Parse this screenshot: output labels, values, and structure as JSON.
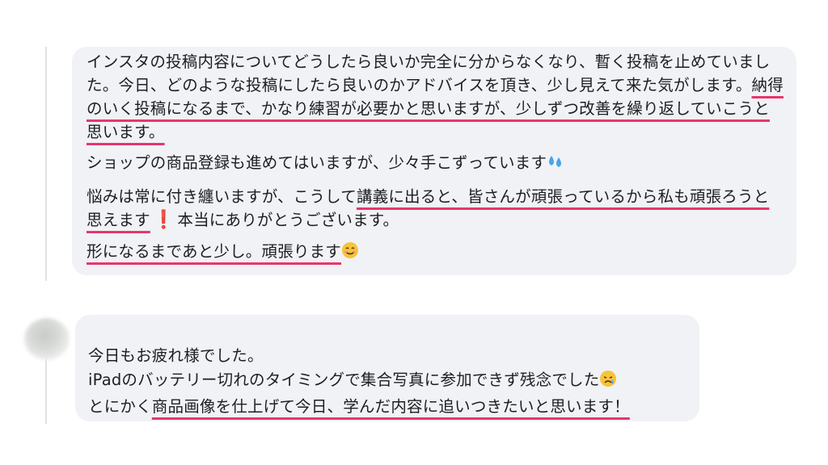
{
  "post": {
    "paragraphs": [
      {
        "segments": [
          {
            "text": "インスタの投稿内容についてどうしたら良いか完全に分からなくなり、暫く投稿を止めていました。今日、どのような投稿にしたら良いのかアドバイスを頂き、少し見えて来た気がします。",
            "u": false
          },
          {
            "text": "納得のいく投稿になるまで、かなり練習が必要かと思いますが、少しずつ改善を繰り返していこうと思います。",
            "u": true
          }
        ]
      },
      {
        "segments": [
          {
            "text": "ショップの商品登録も進めてはいますが、少々手こずっています",
            "u": false
          }
        ],
        "emoji": "sweat-droplets-icon"
      },
      {
        "segments": [
          {
            "text": "悩みは常に付き纏いますが、こうして",
            "u": false
          },
          {
            "text": "講義に出ると、皆さんが頑張っているから私も頑張ろうと思えます",
            "u": true
          },
          {
            "text": "本当にありがとうございます。",
            "u": false
          }
        ],
        "emoji": "exclamation-icon"
      },
      {
        "segments": [
          {
            "text": "形になるまであと少し。頑張ります",
            "u": true
          }
        ],
        "emoji": "smiling-face-icon"
      }
    ]
  },
  "reply": {
    "author": "",
    "line1": "今日もお疲れ様でした。",
    "line2": "iPadのバッテリー切れのタイミングで集合写真に参加できず残念でした",
    "line2_emoji": "crying-face-icon",
    "line3_pre": "とにかく",
    "line3_under": "商品画像を仕上げて今日、学んだ内容に追いつきたいと思います！"
  },
  "colors": {
    "bubble": "#f0f2f5",
    "underline": "#e8356d",
    "text": "#1c1e21",
    "thread_line": "#dfe1e5"
  }
}
